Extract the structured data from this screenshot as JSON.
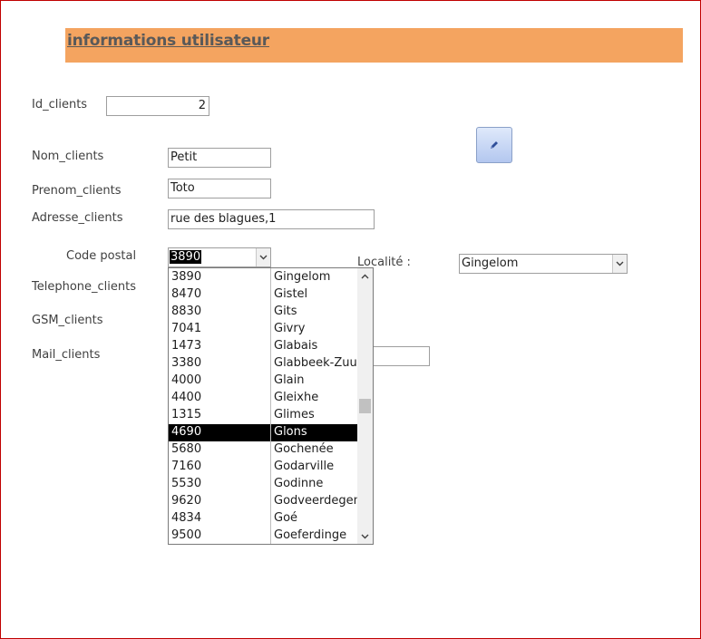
{
  "header": {
    "title": "informations utilisateur"
  },
  "form": {
    "id_label": "Id_clients",
    "id_value": "2",
    "nom_label": "Nom_clients",
    "nom_value": "Petit",
    "prenom_label": "Prenom_clients",
    "prenom_value": "Toto",
    "adresse_label": "Adresse_clients",
    "adresse_value": "rue des blagues,1",
    "cp_label": "Code postal",
    "cp_value": "3890",
    "localite_label": "Localité :",
    "localite_value": "Gingelom",
    "telephone_label": "Telephone_clients",
    "gsm_label": "GSM_clients",
    "mail_label": "Mail_clients"
  },
  "icons": {
    "edit_button": "pencil-icon",
    "combo_arrow": "chevron-down-icon",
    "scroll_up": "chevron-up-icon",
    "scroll_down": "chevron-down-icon"
  },
  "colors": {
    "header_band": "#f4a460",
    "frame_border": "#c00000",
    "selected_row": "#000000"
  },
  "dropdown": {
    "selected_index": 9,
    "scroll_position": 0.5,
    "rows": [
      {
        "code": "3890",
        "name": "Gingelom"
      },
      {
        "code": "8470",
        "name": "Gistel"
      },
      {
        "code": "8830",
        "name": "Gits"
      },
      {
        "code": "7041",
        "name": "Givry"
      },
      {
        "code": "1473",
        "name": "Glabais"
      },
      {
        "code": "3380",
        "name": "Glabbeek-Zuurbemde"
      },
      {
        "code": "4000",
        "name": "Glain"
      },
      {
        "code": "4400",
        "name": "Gleixhe"
      },
      {
        "code": "1315",
        "name": "Glimes"
      },
      {
        "code": "4690",
        "name": "Glons"
      },
      {
        "code": "5680",
        "name": "Gochenée"
      },
      {
        "code": "7160",
        "name": "Godarville"
      },
      {
        "code": "5530",
        "name": "Godinne"
      },
      {
        "code": "9620",
        "name": "Godveerdegem"
      },
      {
        "code": "4834",
        "name": "Goé"
      },
      {
        "code": "9500",
        "name": "Goeferdinge"
      }
    ]
  }
}
